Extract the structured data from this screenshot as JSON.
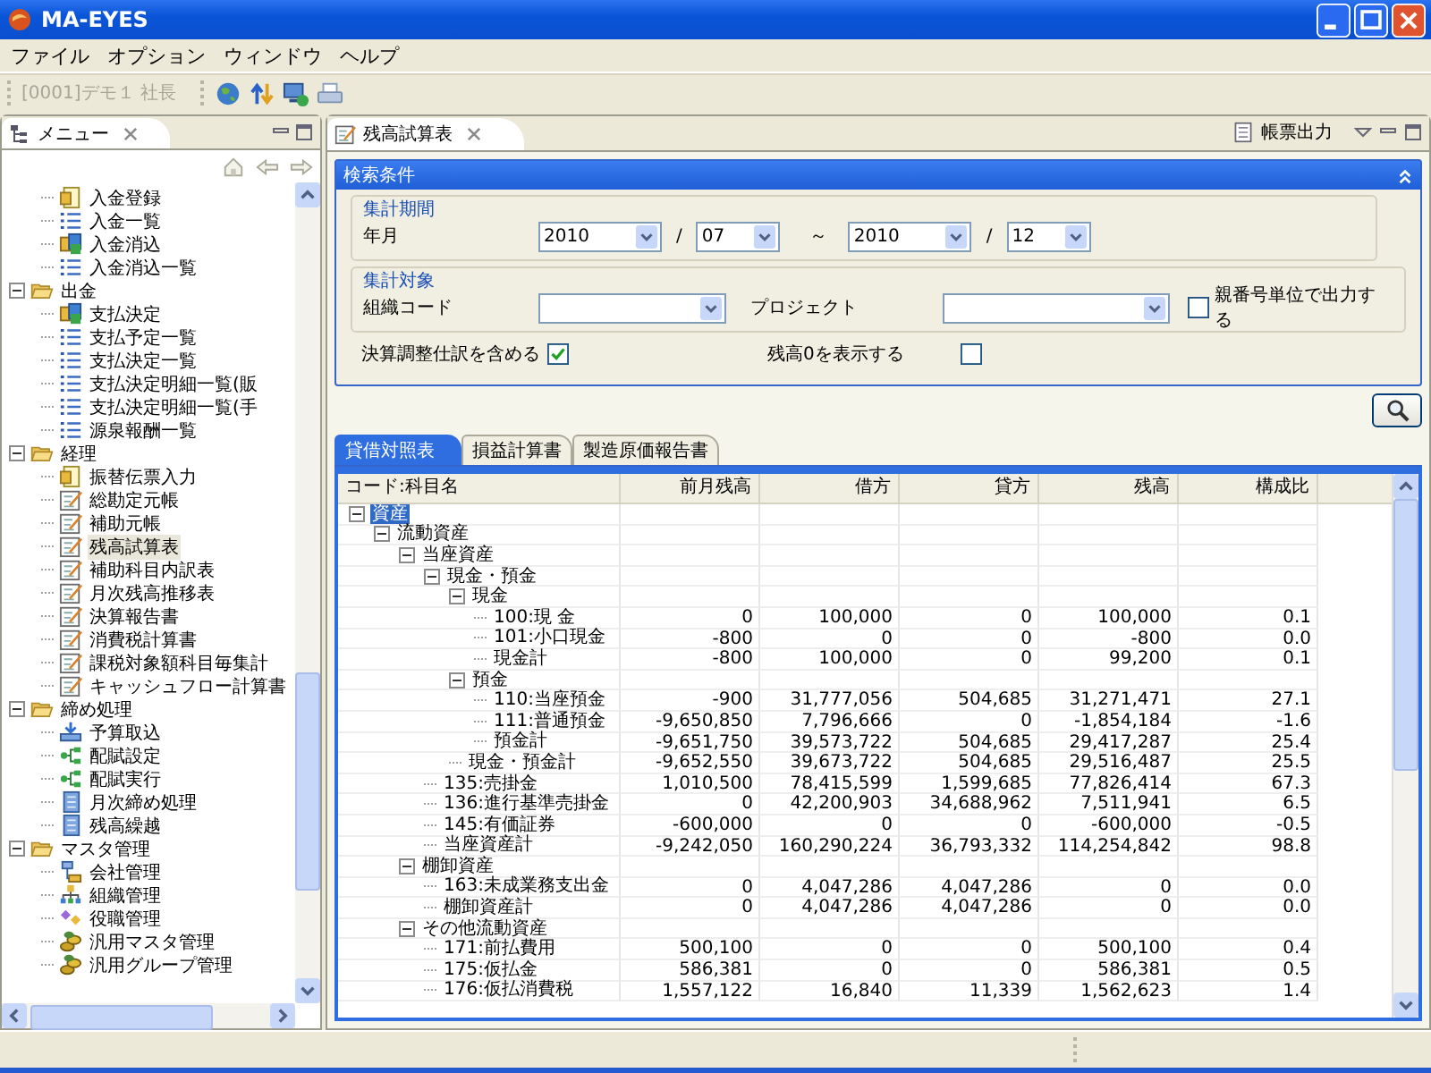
{
  "window": {
    "title": "MA-EYES"
  },
  "menubar": [
    "ファイル",
    "オプション",
    "ウィンドウ",
    "ヘルプ"
  ],
  "toolbar": {
    "user": "[0001]デモ１ 社長"
  },
  "menu_view": {
    "tab": "メニュー",
    "tree": [
      {
        "children": [
          {
            "label": "入金登録",
            "kind": "form",
            "selected": false
          },
          {
            "label": "入金一覧",
            "kind": "list",
            "selected": false
          },
          {
            "label": "入金消込",
            "kind": "match",
            "selected": false
          },
          {
            "label": "入金消込一覧",
            "kind": "list",
            "selected": false
          }
        ]
      },
      {
        "label": "出金",
        "expanded": true,
        "children": [
          {
            "label": "支払決定",
            "kind": "match",
            "selected": false
          },
          {
            "label": "支払予定一覧",
            "kind": "list",
            "selected": false
          },
          {
            "label": "支払決定一覧",
            "kind": "list",
            "selected": false
          },
          {
            "label": "支払決定明細一覧(販",
            "kind": "list",
            "selected": false
          },
          {
            "label": "支払決定明細一覧(手",
            "kind": "list",
            "selected": false
          },
          {
            "label": "源泉報酬一覧",
            "kind": "list",
            "selected": false
          }
        ]
      },
      {
        "label": "経理",
        "expanded": true,
        "children": [
          {
            "label": "振替伝票入力",
            "kind": "form",
            "selected": false
          },
          {
            "label": "総勘定元帳",
            "kind": "report",
            "selected": false
          },
          {
            "label": "補助元帳",
            "kind": "report",
            "selected": false
          },
          {
            "label": "残高試算表",
            "kind": "report",
            "selected": true
          },
          {
            "label": "補助科目内訳表",
            "kind": "report",
            "selected": false
          },
          {
            "label": "月次残高推移表",
            "kind": "report",
            "selected": false
          },
          {
            "label": "決算報告書",
            "kind": "report",
            "selected": false
          },
          {
            "label": "消費税計算書",
            "kind": "report",
            "selected": false
          },
          {
            "label": "課税対象額科目毎集計",
            "kind": "report",
            "selected": false
          },
          {
            "label": "キャッシュフロー計算書",
            "kind": "report",
            "selected": false
          }
        ]
      },
      {
        "label": "締め処理",
        "expanded": true,
        "children": [
          {
            "label": "予算取込",
            "kind": "import",
            "selected": false
          },
          {
            "label": "配賦設定",
            "kind": "flow",
            "selected": false
          },
          {
            "label": "配賦実行",
            "kind": "flow",
            "selected": false
          },
          {
            "label": "月次締め処理",
            "kind": "doc",
            "selected": false
          },
          {
            "label": "残高繰越",
            "kind": "doc",
            "selected": false
          }
        ]
      },
      {
        "label": "マスタ管理",
        "expanded": true,
        "children": [
          {
            "label": "会社管理",
            "kind": "company",
            "selected": false
          },
          {
            "label": "組織管理",
            "kind": "org",
            "selected": false
          },
          {
            "label": "役職管理",
            "kind": "role",
            "selected": false
          },
          {
            "label": "汎用マスタ管理",
            "kind": "coins",
            "selected": false
          },
          {
            "label": "汎用グループ管理",
            "kind": "coins",
            "selected": false
          }
        ]
      }
    ]
  },
  "editor": {
    "tab": "残高試算表",
    "report_output": "帳票出力",
    "search": {
      "title": "検索条件",
      "period": {
        "title": "集計期間",
        "label": "年月",
        "from_year": "2010",
        "from_sep": "/",
        "from_month": "07",
        "range": "～",
        "to_year": "2010",
        "to_sep": "/",
        "to_month": "12"
      },
      "target": {
        "title": "集計対象",
        "org_label": "組織コード",
        "project_label": "プロジェクト",
        "parent_unit": {
          "label": "親番号単位で出力する",
          "checked": false
        }
      },
      "options": [
        {
          "label": "決算調整仕訳を含める",
          "checked": true
        },
        {
          "label": "残高0を表示する",
          "checked": false
        }
      ]
    },
    "report_tabs": [
      {
        "label": "貸借対照表",
        "selected": true
      },
      {
        "label": "損益計算書",
        "selected": false
      },
      {
        "label": "製造原価報告書",
        "selected": false
      }
    ],
    "table": {
      "columns": [
        "コード:科目名",
        "前月残高",
        "借方",
        "貸方",
        "残高",
        "構成比"
      ],
      "rows": [
        {
          "name": "資産",
          "selected": true,
          "expanded": true,
          "children": [
            {
              "name": "流動資産",
              "selected": false,
              "expanded": true,
              "children": [
                {
                  "name": "当座資産",
                  "selected": false,
                  "expanded": true,
                  "children": [
                    {
                      "name": "現金・預金",
                      "selected": false,
                      "expanded": true,
                      "children": [
                        {
                          "name": "現金",
                          "selected": false,
                          "expanded": true,
                          "children": [
                            {
                              "name": "100:現 金",
                              "selected": false,
                              "values": [
                                "0",
                                "100,000",
                                "0",
                                "100,000",
                                "0.1"
                              ]
                            },
                            {
                              "name": "101:小口現金",
                              "selected": false,
                              "values": [
                                "-800",
                                "0",
                                "0",
                                "-800",
                                "0.0"
                              ]
                            },
                            {
                              "name": "現金計",
                              "selected": false,
                              "values": [
                                "-800",
                                "100,000",
                                "0",
                                "99,200",
                                "0.1"
                              ]
                            }
                          ]
                        },
                        {
                          "name": "預金",
                          "selected": false,
                          "expanded": true,
                          "children": [
                            {
                              "name": "110:当座預金",
                              "selected": false,
                              "values": [
                                "-900",
                                "31,777,056",
                                "504,685",
                                "31,271,471",
                                "27.1"
                              ]
                            },
                            {
                              "name": "111:普通預金",
                              "selected": false,
                              "values": [
                                "-9,650,850",
                                "7,796,666",
                                "0",
                                "-1,854,184",
                                "-1.6"
                              ]
                            },
                            {
                              "name": "預金計",
                              "selected": false,
                              "values": [
                                "-9,651,750",
                                "39,573,722",
                                "504,685",
                                "29,417,287",
                                "25.4"
                              ]
                            }
                          ]
                        },
                        {
                          "name": "現金・預金計",
                          "selected": false,
                          "values": [
                            "-9,652,550",
                            "39,673,722",
                            "504,685",
                            "29,516,487",
                            "25.5"
                          ]
                        }
                      ]
                    },
                    {
                      "name": "135:売掛金",
                      "selected": false,
                      "values": [
                        "1,010,500",
                        "78,415,599",
                        "1,599,685",
                        "77,826,414",
                        "67.3"
                      ]
                    },
                    {
                      "name": "136:進行基準売掛金",
                      "selected": false,
                      "values": [
                        "0",
                        "42,200,903",
                        "34,688,962",
                        "7,511,941",
                        "6.5"
                      ]
                    },
                    {
                      "name": "145:有価証券",
                      "selected": false,
                      "values": [
                        "-600,000",
                        "0",
                        "0",
                        "-600,000",
                        "-0.5"
                      ]
                    },
                    {
                      "name": "当座資産計",
                      "selected": false,
                      "values": [
                        "-9,242,050",
                        "160,290,224",
                        "36,793,332",
                        "114,254,842",
                        "98.8"
                      ]
                    }
                  ]
                },
                {
                  "name": "棚卸資産",
                  "selected": false,
                  "expanded": true,
                  "children": [
                    {
                      "name": "163:未成業務支出金",
                      "selected": false,
                      "values": [
                        "0",
                        "4,047,286",
                        "4,047,286",
                        "0",
                        "0.0"
                      ]
                    },
                    {
                      "name": "棚卸資産計",
                      "selected": false,
                      "values": [
                        "0",
                        "4,047,286",
                        "4,047,286",
                        "0",
                        "0.0"
                      ]
                    }
                  ]
                },
                {
                  "name": "その他流動資産",
                  "selected": false,
                  "expanded": true,
                  "children": [
                    {
                      "name": "171:前払費用",
                      "selected": false,
                      "values": [
                        "500,100",
                        "0",
                        "0",
                        "500,100",
                        "0.4"
                      ]
                    },
                    {
                      "name": "175:仮払金",
                      "selected": false,
                      "values": [
                        "586,381",
                        "0",
                        "0",
                        "586,381",
                        "0.5"
                      ]
                    },
                    {
                      "name": "176:仮払消費税",
                      "selected": false,
                      "values": [
                        "1,557,122",
                        "16,840",
                        "11,339",
                        "1,562,623",
                        "1.4"
                      ]
                    }
                  ]
                }
              ]
            }
          ]
        }
      ]
    }
  }
}
